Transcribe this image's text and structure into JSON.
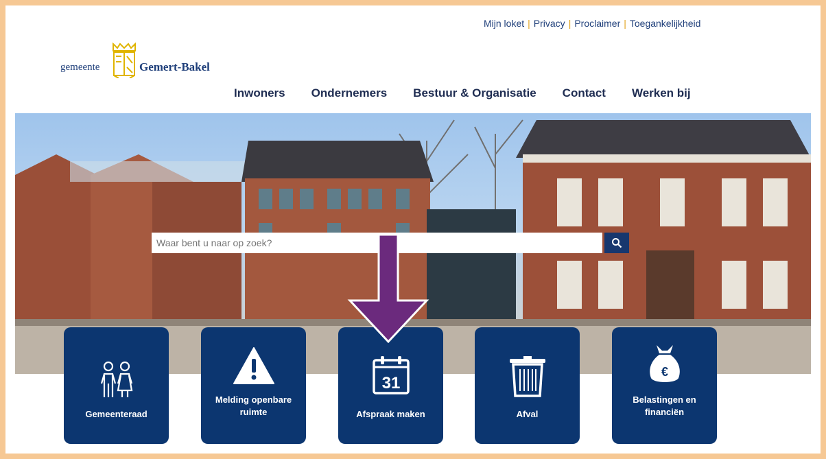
{
  "header": {
    "top_links": [
      "Mijn loket",
      "Privacy",
      "Proclaimer",
      "Toegankelijkheid"
    ],
    "logo": {
      "prefix": "gemeente",
      "name": "Gemert-Bakel"
    },
    "nav": [
      "Inwoners",
      "Ondernemers",
      "Bestuur & Organisatie",
      "Contact",
      "Werken bij"
    ]
  },
  "search": {
    "placeholder": "Waar bent u naar op zoek?",
    "button_icon": "search-icon"
  },
  "tiles": [
    {
      "label": "Gemeenteraad",
      "icon": "people-icon"
    },
    {
      "label": "Melding openbare ruimte",
      "icon": "warning-icon"
    },
    {
      "label": "Afspraak maken",
      "icon": "calendar-icon",
      "icon_text": "31"
    },
    {
      "label": "Afval",
      "icon": "trash-bin-icon"
    },
    {
      "label": "Belastingen en financiën",
      "icon": "money-bag-icon",
      "icon_text": "€"
    }
  ],
  "colors": {
    "accent": "#0c3670",
    "separator": "#e0a21b",
    "annotation_arrow": "#6b2a7d",
    "frame": "#f6c894"
  }
}
